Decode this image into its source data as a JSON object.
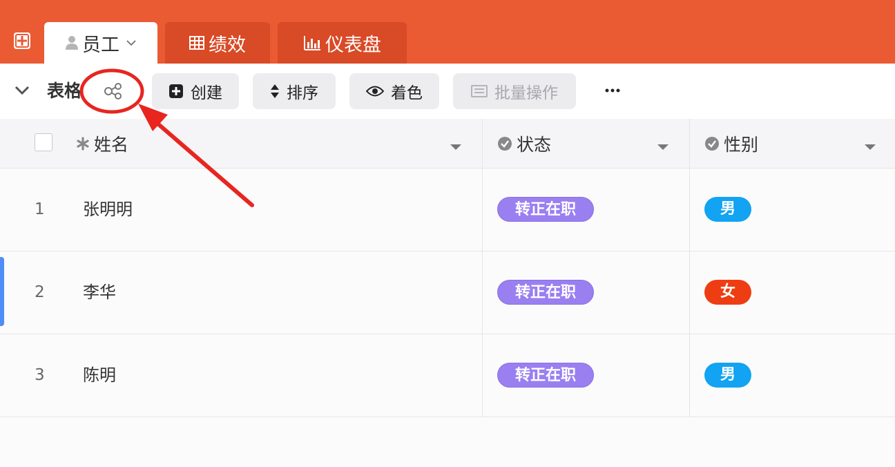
{
  "tabs": [
    {
      "label": "员工",
      "icon": "user-icon",
      "active": true
    },
    {
      "label": "绩效",
      "icon": "grid-icon",
      "active": false
    },
    {
      "label": "仪表盘",
      "icon": "bar-chart-icon",
      "active": false
    }
  ],
  "toolbar": {
    "view_title": "表格",
    "create_label": "创建",
    "sort_label": "排序",
    "color_label": "着色",
    "batch_label": "批量操作",
    "more_label": "···"
  },
  "table": {
    "columns": [
      {
        "label": "姓名",
        "icon": "asterisk-icon"
      },
      {
        "label": "状态",
        "icon": "check-circle-icon"
      },
      {
        "label": "性别",
        "icon": "check-circle-icon"
      }
    ],
    "rows": [
      {
        "num": "1",
        "name": "张明明",
        "status": "转正在职",
        "gender": "男"
      },
      {
        "num": "2",
        "name": "李华",
        "status": "转正在职",
        "gender": "女"
      },
      {
        "num": "3",
        "name": "陈明",
        "status": "转正在职",
        "gender": "男"
      }
    ]
  },
  "colors": {
    "brand": "#ea5a33",
    "status_tag": "#9a7ff1",
    "male_tag": "#12a3f2",
    "female_tag": "#ee3d12",
    "annotation": "#e8251f"
  }
}
